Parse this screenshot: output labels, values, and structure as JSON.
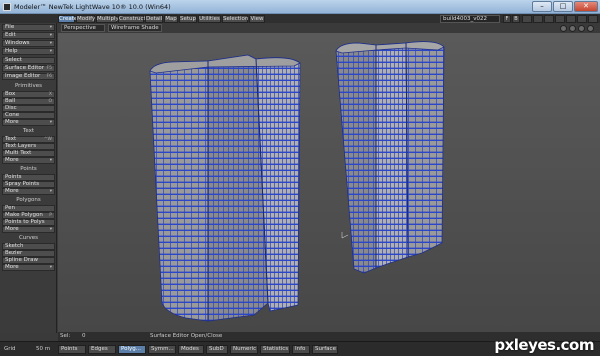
{
  "window": {
    "title": "Modeler™ NewTek LightWave 10® 10.0 (Win64)",
    "minimize": "–",
    "maximize": "□",
    "close": "✕"
  },
  "menus": [
    "File",
    "Edit",
    "Windows",
    "Help"
  ],
  "tabs": [
    {
      "label": "Create",
      "active": true
    },
    {
      "label": "Modify"
    },
    {
      "label": "Multiply"
    },
    {
      "label": "Construct"
    },
    {
      "label": "Detail"
    },
    {
      "label": "Map"
    },
    {
      "label": "Setup"
    },
    {
      "label": "Utilities"
    },
    {
      "label": "Selection"
    },
    {
      "label": "View"
    }
  ],
  "object_selector": "build4003_v022",
  "layer_buttons": [
    "F",
    "B"
  ],
  "sidebar": {
    "top_items": [
      {
        "label": "Select",
        "hotkey": ""
      },
      {
        "label": "Surface Editor",
        "hotkey": "F5"
      },
      {
        "label": "Image Editor",
        "hotkey": "F6"
      }
    ],
    "groups": [
      {
        "header": "Primitives",
        "items": [
          {
            "label": "Box",
            "hotkey": "X"
          },
          {
            "label": "Ball",
            "hotkey": "O"
          },
          {
            "label": "Disc",
            "hotkey": ""
          },
          {
            "label": "Cone",
            "hotkey": ""
          },
          {
            "label": "More",
            "hotkey": ""
          }
        ]
      },
      {
        "header": "Text",
        "items": [
          {
            "label": "Text",
            "hotkey": "^W"
          },
          {
            "label": "Text Layers",
            "hotkey": ""
          },
          {
            "label": "Multi Text",
            "hotkey": ""
          },
          {
            "label": "More",
            "hotkey": ""
          }
        ]
      },
      {
        "header": "Points",
        "items": [
          {
            "label": "Points",
            "hotkey": ""
          },
          {
            "label": "Spray Points",
            "hotkey": ""
          },
          {
            "label": "More",
            "hotkey": ""
          }
        ]
      },
      {
        "header": "Polygons",
        "items": [
          {
            "label": "Pen",
            "hotkey": ""
          },
          {
            "label": "Make Polygon",
            "hotkey": "P"
          },
          {
            "label": "Points to Polys",
            "hotkey": ""
          },
          {
            "label": "More",
            "hotkey": ""
          }
        ]
      },
      {
        "header": "Curves",
        "items": [
          {
            "label": "Sketch",
            "hotkey": ""
          },
          {
            "label": "Bezier",
            "hotkey": ""
          },
          {
            "label": "Spline Draw",
            "hotkey": ""
          },
          {
            "label": "More",
            "hotkey": ""
          }
        ]
      }
    ]
  },
  "viewport": {
    "view": "Perspective",
    "shading": "Wireframe Shade"
  },
  "info_bar": {
    "sel_label": "Sel:",
    "sel_value": "0",
    "message": "Surface Editor Open/Close"
  },
  "status_bar": {
    "grid_label": "Grid",
    "grid_value": "50 m",
    "modes": [
      {
        "label": "Points"
      },
      {
        "label": "Edges"
      },
      {
        "label": "Polyg...",
        "active": true
      }
    ],
    "dropdowns": [
      "Symm...",
      "Modes",
      "SubD",
      "Numeric",
      "Statistics",
      "Info",
      "Surface"
    ]
  },
  "watermark": "pxleyes.com",
  "colors": {
    "accent": "#5b7fa8",
    "wire": "#2b46c8",
    "building": "#8c8c8c"
  }
}
